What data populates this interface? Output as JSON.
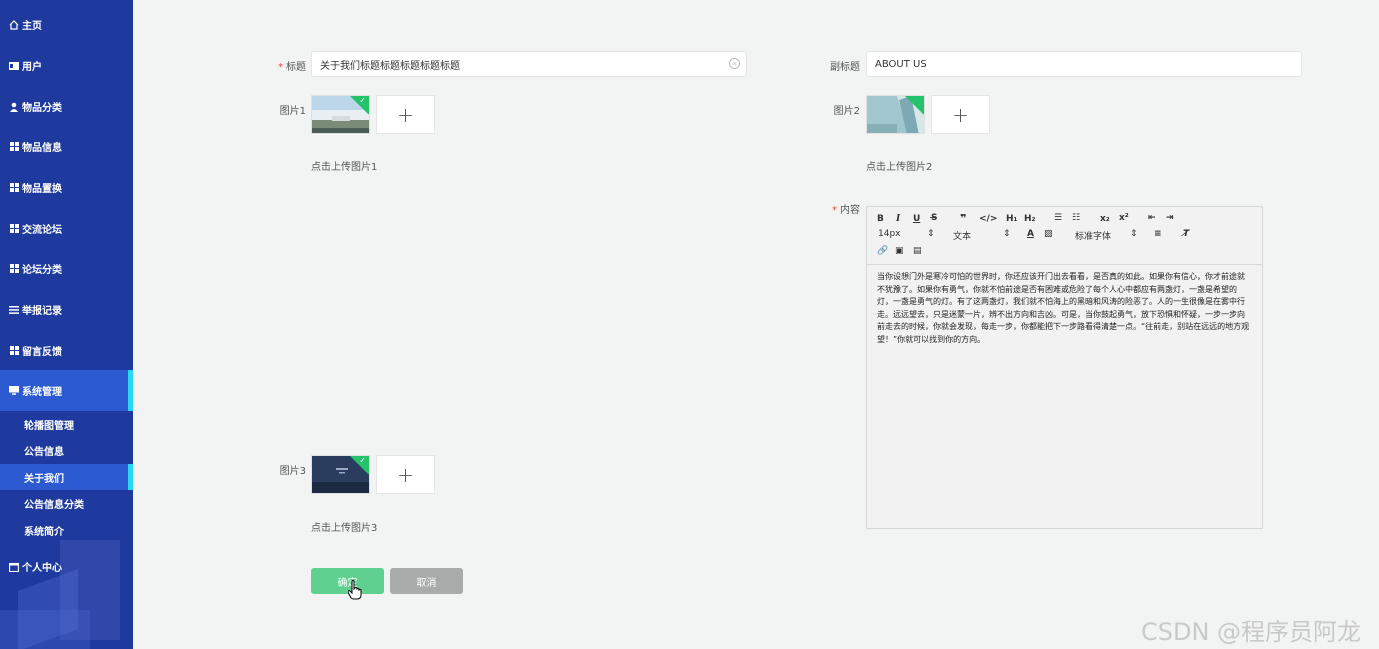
{
  "sidebar": {
    "items": [
      {
        "label": "主页",
        "icon": "home-icon"
      },
      {
        "label": "用户",
        "icon": "card-icon"
      },
      {
        "label": "物品分类",
        "icon": "user-icon"
      },
      {
        "label": "物品信息",
        "icon": "grid-icon"
      },
      {
        "label": "物品置换",
        "icon": "grid-icon"
      },
      {
        "label": "交流论坛",
        "icon": "grid-icon"
      },
      {
        "label": "论坛分类",
        "icon": "grid-icon"
      },
      {
        "label": "举报记录",
        "icon": "list-icon"
      },
      {
        "label": "留言反馈",
        "icon": "grid-icon"
      },
      {
        "label": "系统管理",
        "icon": "monitor-icon"
      },
      {
        "label": "个人中心",
        "icon": "calendar-icon"
      }
    ],
    "subitems": [
      {
        "label": "轮播图管理"
      },
      {
        "label": "公告信息"
      },
      {
        "label": "关于我们"
      },
      {
        "label": "公告信息分类"
      },
      {
        "label": "系统简介"
      }
    ]
  },
  "form": {
    "title_label": "标题",
    "title_value": "关于我们标题标题标题标题标题",
    "subtitle_label": "副标题",
    "subtitle_value": "ABOUT US",
    "pic1_label": "图片1",
    "pic1_hint": "点击上传图片1",
    "pic2_label": "图片2",
    "pic2_hint": "点击上传图片2",
    "pic3_label": "图片3",
    "pic3_hint": "点击上传图片3",
    "content_label": "内容",
    "confirm_label": "确定",
    "cancel_label": "取消"
  },
  "editor": {
    "toolbar": {
      "font_size": "14px",
      "paragraph": "文本",
      "font_family": "标准字体"
    },
    "content": "当你设想门外是寒冷可怕的世界时，你还应该开门出去看看，是否真的如此。如果你有信心，你才前途就不犹豫了。如果你有勇气，你就不怕前途是否有困难或危险了每个人心中都应有两盏灯，一盏是希望的灯，一盏是勇气的灯。有了这两盏灯，我们就不怕海上的黑暗和风涛的险恶了。人的一生很像是在雾中行走。远远望去，只是迷蒙一片，辨不出方向和吉凶。可是，当你鼓起勇气，放下恐惧和怀疑，一步一步向前走去的时候，你就会发现，每走一步，你都能把下一步路看得清楚一点。“往前走，别站在远远的地方观望！”你就可以找到你的方向。"
  },
  "colors": {
    "sidebar_bg": "#1f3a9e",
    "active_bg": "#2c5ad0",
    "accent": "#28d7f3",
    "confirm": "#5fd08f",
    "cancel": "#a9abaa"
  },
  "watermark": "CSDN @程序员阿龙"
}
